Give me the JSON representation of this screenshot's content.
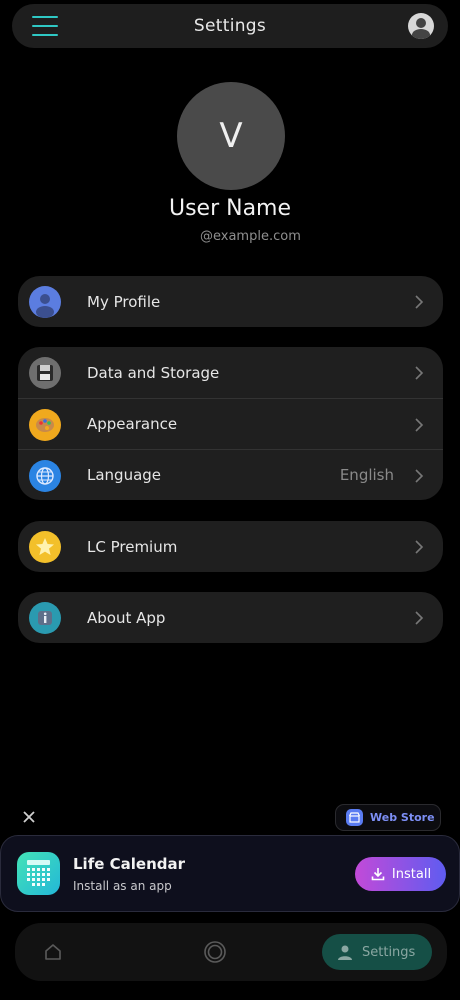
{
  "header": {
    "title": "Settings",
    "menu_icon": "hamburger-menu-icon",
    "avatar_icon": "user-avatar-icon",
    "accent_color": "#2fc8c4"
  },
  "profile": {
    "initial": "V",
    "name": "User Name",
    "email": "@example.com"
  },
  "groups": [
    [
      {
        "label": "My Profile",
        "icon": "person-icon",
        "icon_bg": "#5b7de0"
      }
    ],
    [
      {
        "label": "Data and Storage",
        "icon": "floppy-disk-icon",
        "icon_bg": "#6f6f6f"
      },
      {
        "label": "Appearance",
        "icon": "palette-icon",
        "icon_bg": "#f0a91e"
      },
      {
        "label": "Language",
        "icon": "globe-icon",
        "icon_bg": "#2b84e3",
        "value": "English"
      }
    ],
    [
      {
        "label": "LC Premium",
        "icon": "star-icon",
        "icon_bg": "#f3c02a"
      }
    ],
    [
      {
        "label": "About App",
        "icon": "info-icon",
        "icon_bg": "#2a9ab0"
      }
    ]
  ],
  "install_prompt": {
    "close_icon": "close-icon",
    "web_store_label": "Web Store",
    "web_store_icon": "store-icon",
    "app_title": "Life Calendar",
    "app_subtitle": "Install as an app",
    "install_label": "Install",
    "install_icon": "download-icon"
  },
  "bottom_nav": {
    "home_icon": "home-icon",
    "ring_icon": "ring-icon",
    "settings_label": "Settings",
    "settings_icon": "person-icon",
    "active_color": "#154f46"
  }
}
